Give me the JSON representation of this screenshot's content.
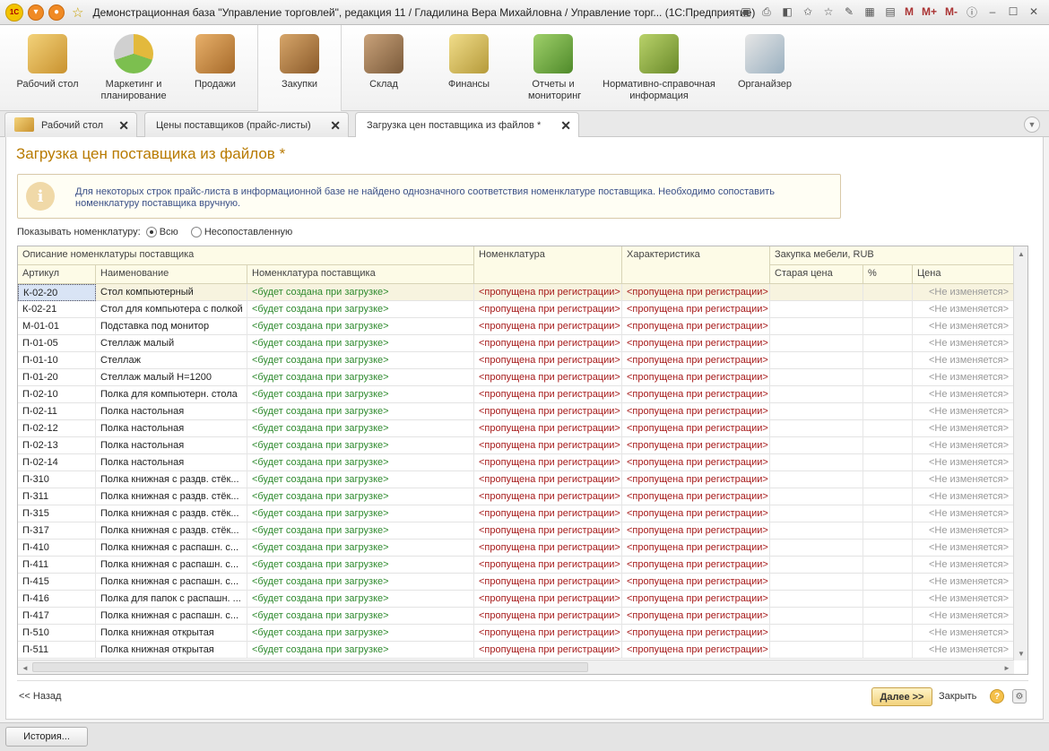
{
  "window": {
    "title": "Демонстрационная база \"Управление торговлей\", редакция 11 / Гладилина Вера Михайловна / Управление торг...  (1С:Предприятие)",
    "toolbar_m_labels": [
      "M",
      "M+",
      "M-"
    ]
  },
  "sections": [
    {
      "label": "Рабочий стол",
      "icon": "desk-icon",
      "color": "#d9a640"
    },
    {
      "label": "Маркетинг и планирование",
      "icon": "pie-chart-icon",
      "color": "#6aa84f"
    },
    {
      "label": "Продажи",
      "icon": "truck-icon",
      "color": "#d58b3a"
    },
    {
      "label": "Закупки",
      "icon": "boxes-icon",
      "color": "#b6823e"
    },
    {
      "label": "Склад",
      "icon": "shelves-icon",
      "color": "#a7784a"
    },
    {
      "label": "Финансы",
      "icon": "coins-icon",
      "color": "#c9b04a"
    },
    {
      "label": "Отчеты и мониторинг",
      "icon": "report-chart-icon",
      "color": "#5fa04a"
    },
    {
      "label": "Нормативно-справочная информация",
      "icon": "binders-icon",
      "color": "#7aa84a"
    },
    {
      "label": "Органайзер",
      "icon": "clipboard-icon",
      "color": "#4f8aa8"
    }
  ],
  "tabs": [
    {
      "label": "Рабочий стол"
    },
    {
      "label": "Цены поставщиков (прайс-листы)"
    },
    {
      "label": "Загрузка цен поставщика из файлов *"
    }
  ],
  "form": {
    "title": "Загрузка цен поставщика из файлов *",
    "info_text": "Для некоторых строк прайс-листа в информационной базе не найдено однозначного соответствия номенклатуре поставщика. Необходимо сопоставить номенклатуру поставщика вручную.",
    "filter_label": "Показывать номенклатуру:",
    "filter_options": [
      "Всю",
      "Несопоставленную"
    ],
    "filter_selected": "Всю"
  },
  "grid": {
    "group_headers": {
      "description": "Описание номенклатуры поставщика",
      "nomenclature": "Номенклатура",
      "characteristic": "Характеристика",
      "purchase": "Закупка мебели, RUB"
    },
    "columns": {
      "article": "Артикул",
      "name": "Наименование",
      "supplier_nom": "Номенклатура поставщика",
      "old_price": "Старая цена",
      "percent": "%",
      "price": "Цена"
    },
    "rows": [
      {
        "article": "К-02-20",
        "name": "Стол компьютерный",
        "supplier_nom": "<будет создана при загрузке>",
        "nom": "<пропущена при регистрации>",
        "char": "<пропущена при регистрации>",
        "price": "<Не изменяется>"
      },
      {
        "article": "К-02-21",
        "name": "Стол для компьютера с полкой",
        "supplier_nom": "<будет создана при загрузке>",
        "nom": "<пропущена при регистрации>",
        "char": "<пропущена при регистрации>",
        "price": "<Не изменяется>"
      },
      {
        "article": "М-01-01",
        "name": "Подставка под монитор",
        "supplier_nom": "<будет создана при загрузке>",
        "nom": "<пропущена при регистрации>",
        "char": "<пропущена при регистрации>",
        "price": "<Не изменяется>"
      },
      {
        "article": "П-01-05",
        "name": "Стеллаж малый",
        "supplier_nom": "<будет создана при загрузке>",
        "nom": "<пропущена при регистрации>",
        "char": "<пропущена при регистрации>",
        "price": "<Не изменяется>"
      },
      {
        "article": "П-01-10",
        "name": "Стеллаж",
        "supplier_nom": "<будет создана при загрузке>",
        "nom": "<пропущена при регистрации>",
        "char": "<пропущена при регистрации>",
        "price": "<Не изменяется>"
      },
      {
        "article": "П-01-20",
        "name": "Стеллаж малый Н=1200",
        "supplier_nom": "<будет создана при загрузке>",
        "nom": "<пропущена при регистрации>",
        "char": "<пропущена при регистрации>",
        "price": "<Не изменяется>"
      },
      {
        "article": "П-02-10",
        "name": "Полка для компьютерн. стола",
        "supplier_nom": "<будет создана при загрузке>",
        "nom": "<пропущена при регистрации>",
        "char": "<пропущена при регистрации>",
        "price": "<Не изменяется>"
      },
      {
        "article": "П-02-11",
        "name": "Полка настольная",
        "supplier_nom": "<будет создана при загрузке>",
        "nom": "<пропущена при регистрации>",
        "char": "<пропущена при регистрации>",
        "price": "<Не изменяется>"
      },
      {
        "article": "П-02-12",
        "name": "Полка настольная",
        "supplier_nom": "<будет создана при загрузке>",
        "nom": "<пропущена при регистрации>",
        "char": "<пропущена при регистрации>",
        "price": "<Не изменяется>"
      },
      {
        "article": "П-02-13",
        "name": "Полка настольная",
        "supplier_nom": "<будет создана при загрузке>",
        "nom": "<пропущена при регистрации>",
        "char": "<пропущена при регистрации>",
        "price": "<Не изменяется>"
      },
      {
        "article": "П-02-14",
        "name": "Полка настольная",
        "supplier_nom": "<будет создана при загрузке>",
        "nom": "<пропущена при регистрации>",
        "char": "<пропущена при регистрации>",
        "price": "<Не изменяется>"
      },
      {
        "article": "П-310",
        "name": "Полка книжная с раздв. стёк...",
        "supplier_nom": "<будет создана при загрузке>",
        "nom": "<пропущена при регистрации>",
        "char": "<пропущена при регистрации>",
        "price": "<Не изменяется>"
      },
      {
        "article": "П-311",
        "name": "Полка книжная с раздв. стёк...",
        "supplier_nom": "<будет создана при загрузке>",
        "nom": "<пропущена при регистрации>",
        "char": "<пропущена при регистрации>",
        "price": "<Не изменяется>"
      },
      {
        "article": "П-315",
        "name": "Полка книжная с раздв. стёк...",
        "supplier_nom": "<будет создана при загрузке>",
        "nom": "<пропущена при регистрации>",
        "char": "<пропущена при регистрации>",
        "price": "<Не изменяется>"
      },
      {
        "article": "П-317",
        "name": "Полка книжная с раздв. стёк...",
        "supplier_nom": "<будет создана при загрузке>",
        "nom": "<пропущена при регистрации>",
        "char": "<пропущена при регистрации>",
        "price": "<Не изменяется>"
      },
      {
        "article": "П-410",
        "name": "Полка книжная с распашн. с...",
        "supplier_nom": "<будет создана при загрузке>",
        "nom": "<пропущена при регистрации>",
        "char": "<пропущена при регистрации>",
        "price": "<Не изменяется>"
      },
      {
        "article": "П-411",
        "name": "Полка книжная с распашн. с...",
        "supplier_nom": "<будет создана при загрузке>",
        "nom": "<пропущена при регистрации>",
        "char": "<пропущена при регистрации>",
        "price": "<Не изменяется>"
      },
      {
        "article": "П-415",
        "name": "Полка книжная с распашн. с...",
        "supplier_nom": "<будет создана при загрузке>",
        "nom": "<пропущена при регистрации>",
        "char": "<пропущена при регистрации>",
        "price": "<Не изменяется>"
      },
      {
        "article": "П-416",
        "name": "Полка для папок с распашн. ...",
        "supplier_nom": "<будет создана при загрузке>",
        "nom": "<пропущена при регистрации>",
        "char": "<пропущена при регистрации>",
        "price": "<Не изменяется>"
      },
      {
        "article": "П-417",
        "name": "Полка книжная с распашн. с...",
        "supplier_nom": "<будет создана при загрузке>",
        "nom": "<пропущена при регистрации>",
        "char": "<пропущена при регистрации>",
        "price": "<Не изменяется>"
      },
      {
        "article": "П-510",
        "name": "Полка книжная открытая",
        "supplier_nom": "<будет создана при загрузке>",
        "nom": "<пропущена при регистрации>",
        "char": "<пропущена при регистрации>",
        "price": "<Не изменяется>"
      },
      {
        "article": "П-511",
        "name": "Полка книжная открытая",
        "supplier_nom": "<будет создана при загрузке>",
        "nom": "<пропущена при регистрации>",
        "char": "<пропущена при регистрации>",
        "price": "<Не изменяется>"
      }
    ]
  },
  "buttons": {
    "back": "<< Назад",
    "next": "Далее >>",
    "close": "Закрыть",
    "history": "История..."
  }
}
